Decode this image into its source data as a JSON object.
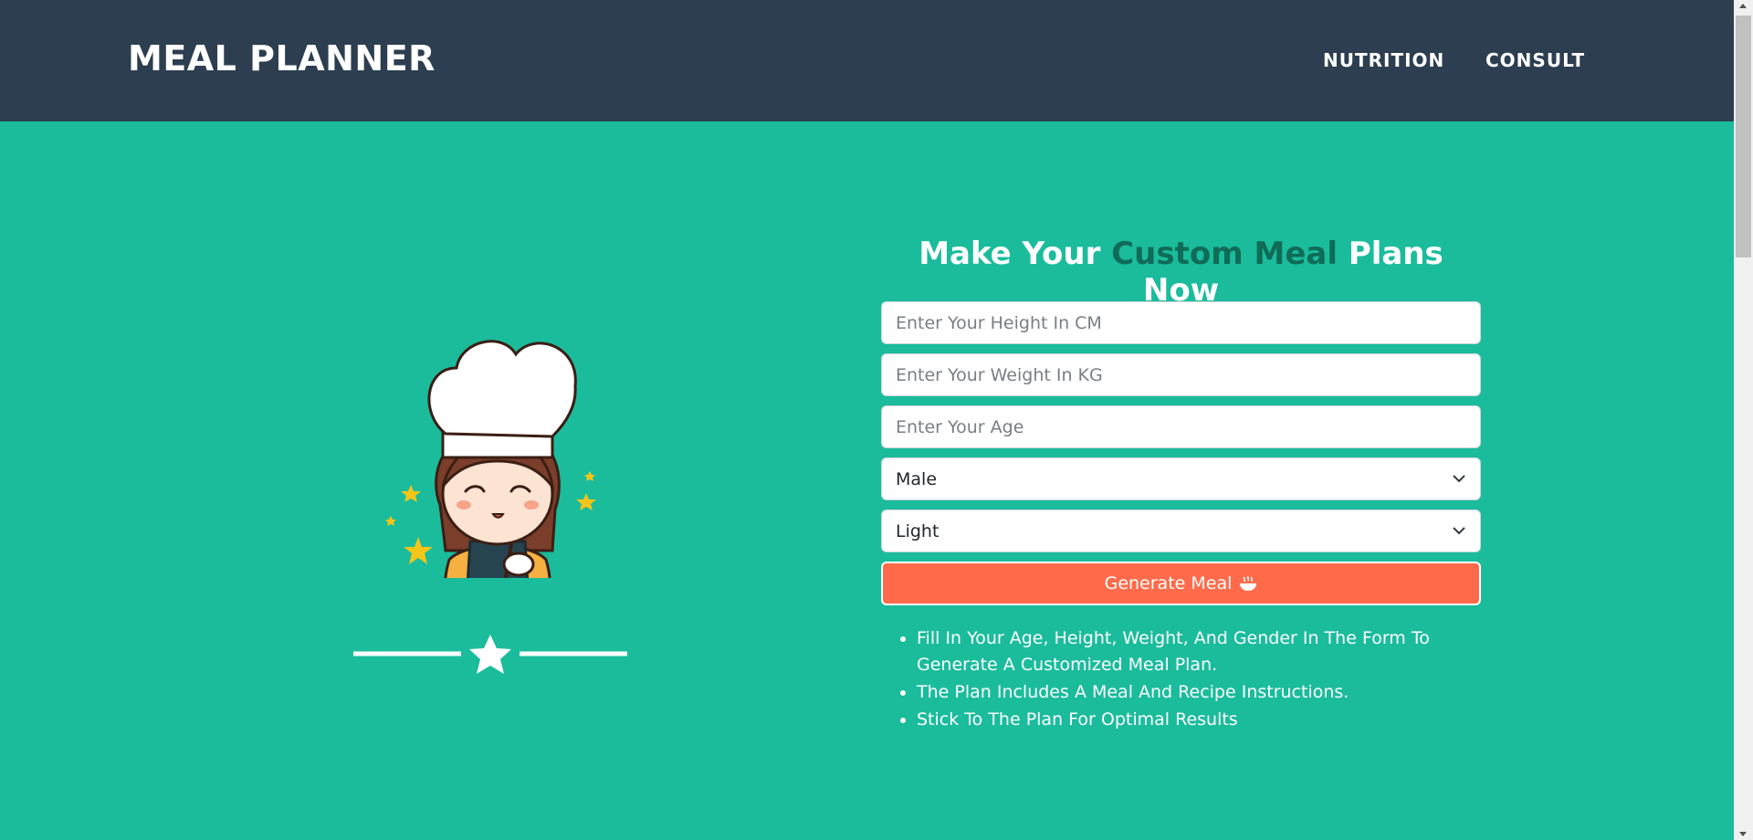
{
  "navbar": {
    "brand": "MEAL PLANNER",
    "links": [
      "NUTRITION",
      "CONSULT"
    ],
    "background": "#2c3e50"
  },
  "hero": {
    "background": "#1abc9c",
    "heading": {
      "part1": "Make Your ",
      "accent": "Custom Meal",
      "part2": " Plans Now",
      "accent_color": "#106b57"
    },
    "illustration": "chef-girl-illustration",
    "divider_icon": "star-icon"
  },
  "form": {
    "height_placeholder": "Enter Your Height In CM",
    "weight_placeholder": "Enter Your Weight In KG",
    "age_placeholder": "Enter Your Age",
    "gender_value": "Male",
    "activity_value": "Light",
    "button_label": "Generate Meal",
    "button_icon": "bowl-icon",
    "button_color": "#ff6b4a"
  },
  "instructions": [
    "Fill In Your Age, Height, Weight, And Gender In The Form To Generate A Customized Meal Plan.",
    "The Plan Includes A Meal And Recipe Instructions.",
    "Stick To The Plan For Optimal Results"
  ]
}
